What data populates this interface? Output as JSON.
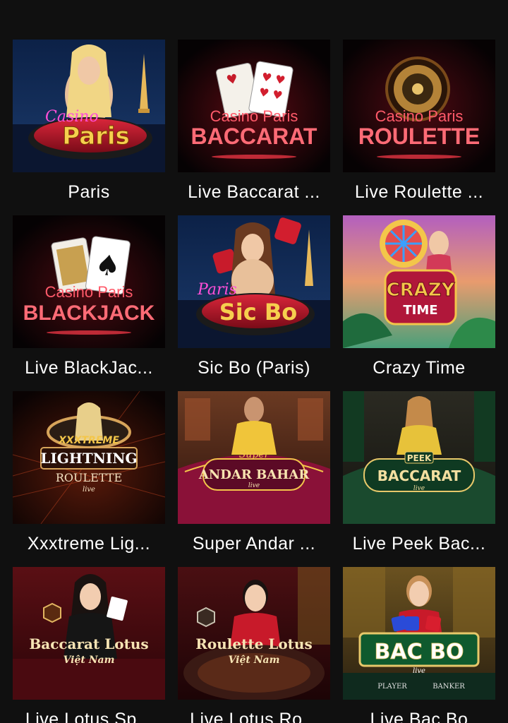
{
  "colors": {
    "background": "#101010",
    "title_text": "#ffffff",
    "neon_red": "#ff3b4a",
    "gold": "#f3c64a"
  },
  "games": [
    {
      "id": "paris",
      "title": "Paris",
      "art": {
        "brand_script": "Casino",
        "main": "Paris"
      }
    },
    {
      "id": "baccarat",
      "title": "Live Baccarat ...",
      "art": {
        "brand": "Casino Paris",
        "main": "BACCARAT"
      }
    },
    {
      "id": "roulette",
      "title": "Live Roulette ...",
      "art": {
        "brand": "Casino Paris",
        "main": "ROULETTE"
      }
    },
    {
      "id": "blackjack",
      "title": "Live BlackJac...",
      "art": {
        "brand": "Casino Paris",
        "main": "BLACKJACK"
      }
    },
    {
      "id": "sicbo",
      "title": "Sic Bo (Paris)",
      "art": {
        "brand_script": "Paris",
        "main": "Sic Bo"
      }
    },
    {
      "id": "crazytime",
      "title": "Crazy Time",
      "art": {
        "line1": "CRAZY",
        "line2": "TIME"
      }
    },
    {
      "id": "xxxtreme",
      "title": "Xxxtreme Lig...",
      "art": {
        "line1": "XXXTREME",
        "line2": "LIGHTNING",
        "line3": "ROULETTE",
        "tag": "live"
      }
    },
    {
      "id": "andarbahar",
      "title": "Super Andar ...",
      "art": {
        "line1": "Super",
        "line2": "ANDAR BAHAR",
        "tag": "live"
      }
    },
    {
      "id": "peekbaccarat",
      "title": "Live Peek Bac...",
      "art": {
        "line1": "PEEK",
        "line2": "BACCARAT",
        "tag": "live"
      }
    },
    {
      "id": "lotusspeed",
      "title": "Live Lotus Sp...",
      "art": {
        "line1": "Baccarat Lotus",
        "line2": "Việt Nam"
      }
    },
    {
      "id": "lotusroulette",
      "title": "Live Lotus Ro...",
      "art": {
        "line1": "Roulette Lotus",
        "line2": "Việt Nam"
      }
    },
    {
      "id": "bacbo",
      "title": "Live Bac Bo",
      "art": {
        "line1": "BAC BO",
        "tag": "live",
        "left": "PLAYER",
        "right": "BANKER"
      }
    }
  ]
}
